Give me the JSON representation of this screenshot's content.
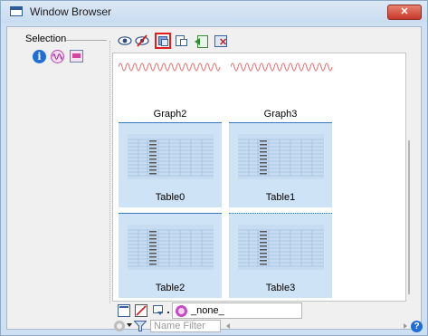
{
  "window": {
    "title": "Window Browser",
    "close_glyph": "✕"
  },
  "left_pane": {
    "section_label": "Selection",
    "icons": [
      "info-icon",
      "waveform-icon",
      "chart-icon"
    ],
    "info_glyph": "i"
  },
  "toolbar": {
    "icons": [
      "eye-icon",
      "hidden-eye-icon",
      "duplicate-icon",
      "paste-icon",
      "bring-back-icon",
      "delete-window-icon"
    ],
    "active_icon": "duplicate-icon",
    "highlight_color": "#e01e1e"
  },
  "thumbnails": {
    "graphs": [
      {
        "caption": "Graph2"
      },
      {
        "caption": "Graph3"
      }
    ],
    "tables": [
      {
        "caption": "Table0"
      },
      {
        "caption": "Table1"
      },
      {
        "caption": "Table2"
      },
      {
        "caption": "Table3"
      }
    ],
    "table_fill_color": "#cfe3f6",
    "waveform_color": "#e06b6b"
  },
  "bottom_bar": {
    "layer_value": "_none_",
    "filter_placeholder": "Name Filter",
    "help_glyph": "?"
  }
}
